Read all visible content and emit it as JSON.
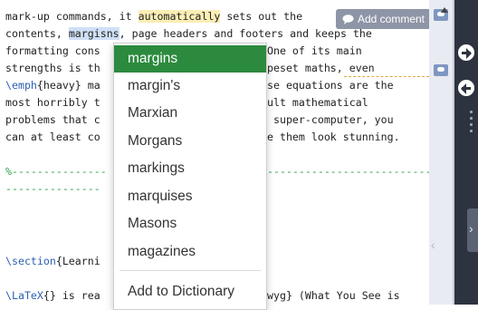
{
  "comment": {
    "add_label": "Add comment",
    "icon": "comment-bubble-icon"
  },
  "editor": {
    "line1": {
      "a": "mark-up commands, it ",
      "hl": "automatically",
      "b": " sets out the"
    },
    "line2": {
      "a": "contents, ",
      "hl": "margisns",
      "b": ", page headers and footers and keeps the"
    },
    "line3": {
      "a": "formatting cons",
      "b": "One of its main"
    },
    "line4": {
      "a": "strengths is th",
      "b": "peset maths, even"
    },
    "line5": {
      "cmd": "\\emph",
      "a": "{heavy} ma",
      "b": "se equations are the"
    },
    "line6": {
      "a": "most horribly t",
      "b": "ult mathematical"
    },
    "line7": {
      "a": "problems that c",
      "b": " super-computer, you"
    },
    "line8": {
      "a": "can at least co",
      "b": "e them look stunning."
    },
    "line9": {
      "a": "%---------------",
      "b": "----------------------------"
    },
    "line10": {
      "a": "---------------"
    },
    "line11": {
      "cmd": "\\section",
      "a": "{Learni"
    },
    "line12": {
      "cmd": "\\LaTeX",
      "a": "{} is rea",
      "b": "wyg} (What You See is"
    }
  },
  "spell_menu": {
    "suggestions": [
      "margins",
      "margin's",
      "Marxian",
      "Morgans",
      "markings",
      "marquises",
      "Masons",
      "magazines"
    ],
    "add_to_dictionary": "Add to Dictionary"
  },
  "colors": {
    "selected": "#2b8a3e",
    "highlight_yellow": "#fbeeb5",
    "highlight_blue": "#cfe0f6",
    "side_panel": "#2d3340"
  }
}
